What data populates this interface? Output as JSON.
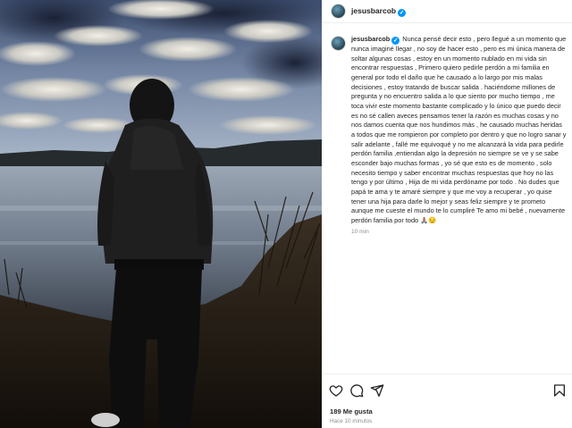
{
  "post": {
    "username": "jesusbarcob",
    "verified_icon": "verified-badge-icon",
    "caption": "Nunca pensé decir esto , pero llegué a un momento que nunca imaginé llegar , no soy de hacer esto , pero es mi única manera de soltar algunas cosas , estoy en un momento nublado en mi vida sin encontrar respuestas , Primero quiero pedirle perdón a mi familia en general por todo el daño que he causado a lo largo por mis malas decisiones , estoy tratando de buscar salida . haciéndome millones de pregunta y no encuentro salida a lo que siento por mucho tiempo , me toca vivir este momento bastante complicado y lo único que puedo decir es no sé callen aveces pensamos tener la razón es muchas cosas y no nos damos cuenta que nos hundimos más , he causado muchas heridas a todos que me rompieron por completo por dentro y que no logro sanar y salir adelante , fallé me equivoqué y no me alcanzará la vida para pedirle perdón familia ,entiendan algo la depresión no siempre se ve y se sabe esconder bajo muchas formas , yo sé que esto es de momento , solo necesito tiempo y saber encontrar muchas respuestas que hoy no las tengo y por último , Hija de mi vida perdóname por todo . No dudes que papá te ama y te amaré siempre y que me voy a recuperar , yo quise tener una hija para darle lo mejor y seas feliz siempre y te prometo aunque me cueste el mundo te lo cumpliré Te amo mi bebé , nuevamente perdón familia por todo 🙏🏽😔",
    "caption_time": "10 min",
    "likes": "189 Me gusta",
    "posted_ago": "Hace 10 minutos"
  },
  "icons": {
    "like": "heart-icon",
    "comment": "comment-icon",
    "share": "share-icon",
    "save": "bookmark-icon"
  },
  "colors": {
    "verified": "#0095f6",
    "text": "#262626",
    "muted": "#8e8e8e"
  }
}
